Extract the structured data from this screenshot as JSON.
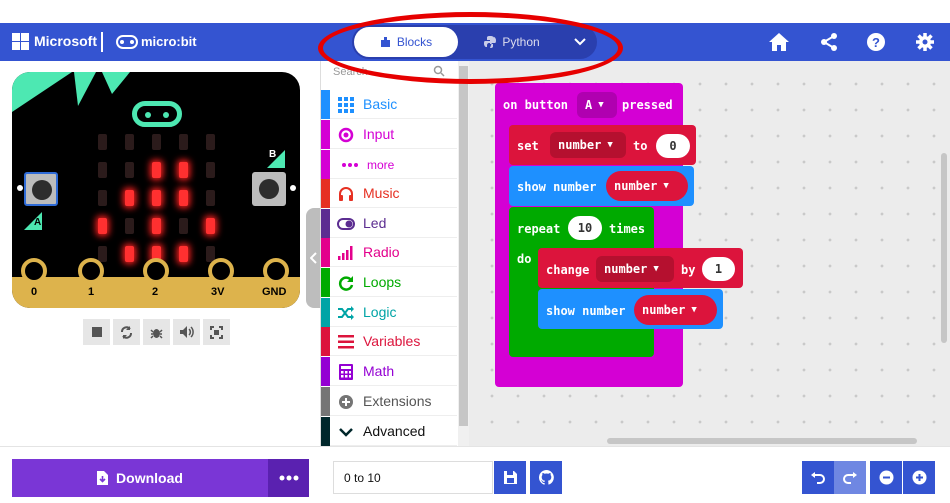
{
  "header": {
    "brand": "Microsoft",
    "product": "micro:bit",
    "tabs": {
      "blocks": "Blocks",
      "python": "Python"
    },
    "icons": [
      "home-icon",
      "share-icon",
      "help-icon",
      "settings-icon"
    ]
  },
  "simulator": {
    "pin_labels": [
      "0",
      "1",
      "2",
      "3V",
      "GND"
    ],
    "button_labels": {
      "a": "A",
      "b": "B"
    },
    "tools": [
      "stop-icon",
      "restart-icon",
      "debug-icon",
      "mute-icon",
      "fullscreen-icon"
    ]
  },
  "toolbox": {
    "search_placeholder": "Search...",
    "categories": [
      {
        "label": "Basic",
        "color": "#1e90ff",
        "icon": "grid-icon"
      },
      {
        "label": "Input",
        "color": "#d400d4",
        "icon": "circle-target-icon"
      },
      {
        "label": "more",
        "color": "#d400d4",
        "icon": "more-dots-icon"
      },
      {
        "label": "Music",
        "color": "#e63022",
        "icon": "headphones-icon"
      },
      {
        "label": "Led",
        "color": "#5c2d91",
        "icon": "toggle-icon"
      },
      {
        "label": "Radio",
        "color": "#e3008c",
        "icon": "signal-bars-icon"
      },
      {
        "label": "Loops",
        "color": "#00aa00",
        "icon": "loop-arrow-icon"
      },
      {
        "label": "Logic",
        "color": "#00a4a6",
        "icon": "shuffle-icon"
      },
      {
        "label": "Variables",
        "color": "#dc143c",
        "icon": "list-lines-icon"
      },
      {
        "label": "Math",
        "color": "#9400d3",
        "icon": "calculator-icon"
      },
      {
        "label": "Extensions",
        "color": "#757575",
        "icon": "plus-circle-icon"
      },
      {
        "label": "Advanced",
        "color": "#00272b",
        "icon": "chevron-down-icon"
      }
    ]
  },
  "blocks": {
    "event": {
      "prefix": "on button",
      "button": "A",
      "suffix": "pressed",
      "color": "#d400d4"
    },
    "set": {
      "keyword": "set",
      "var": "number",
      "to": "to",
      "value": "0",
      "color": "#dc143c"
    },
    "show1": {
      "keyword": "show number",
      "var": "number",
      "color": "#1e90ff"
    },
    "repeat": {
      "keyword": "repeat",
      "count": "10",
      "suffix": "times",
      "do": "do",
      "color": "#00aa00"
    },
    "change": {
      "keyword": "change",
      "var": "number",
      "by": "by",
      "value": "1",
      "color": "#dc143c"
    },
    "show2": {
      "keyword": "show number",
      "var": "number",
      "color": "#1e90ff"
    }
  },
  "footer": {
    "download_label": "Download",
    "project_name": "0 to 10"
  },
  "colors": {
    "header": "#3454d1",
    "download": "#7a36d6",
    "highlight": "#e60000"
  }
}
